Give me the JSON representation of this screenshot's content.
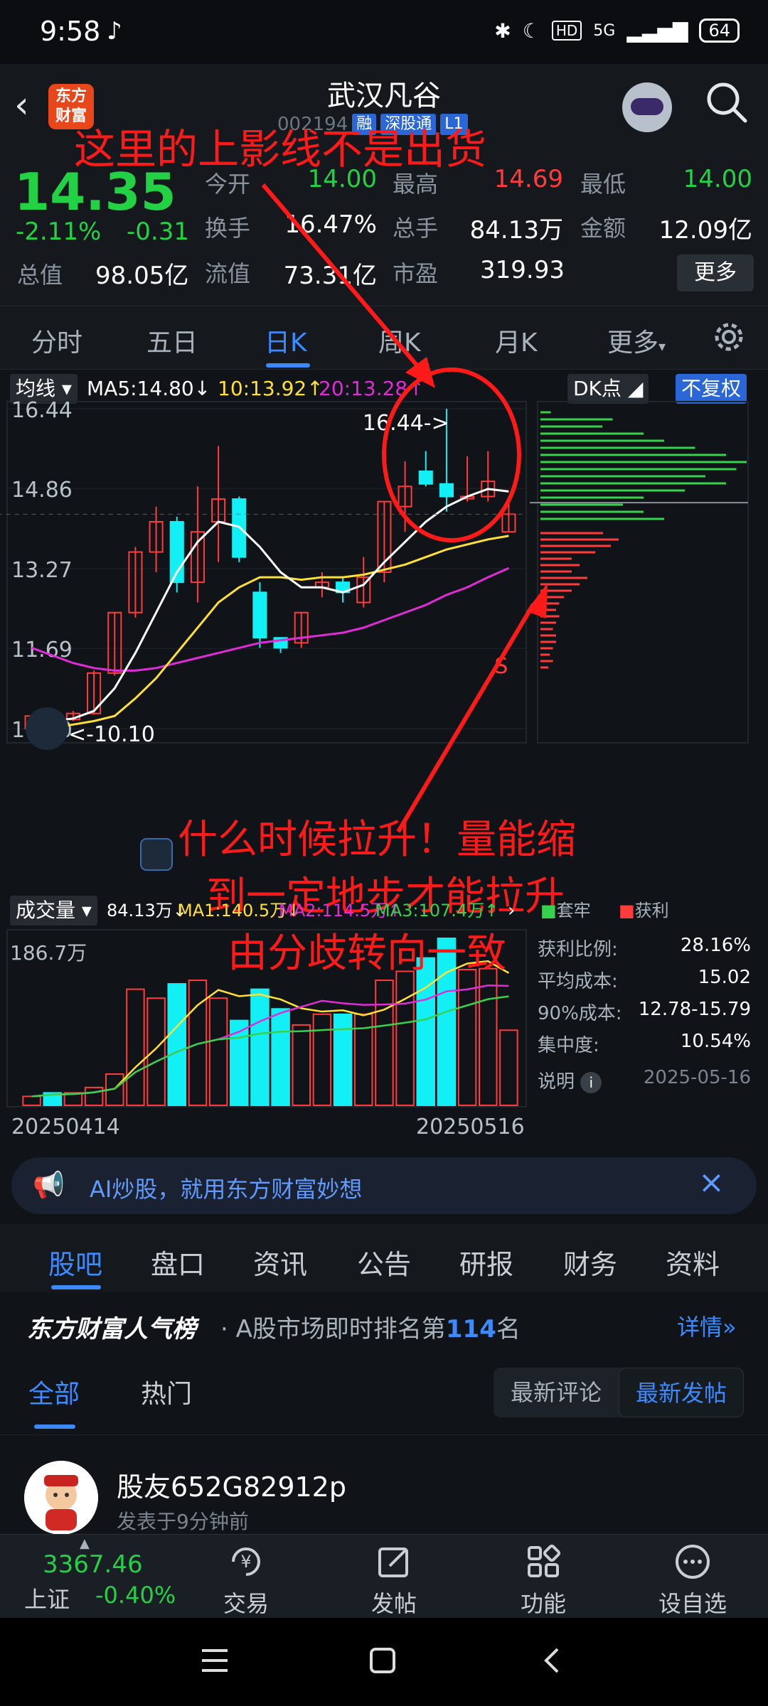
{
  "status_bar": {
    "time": "9:58",
    "network": "5G",
    "hd": "HD",
    "battery": "64"
  },
  "header": {
    "back": "‹",
    "logo_line1": "东方",
    "logo_line2": "财富",
    "stock_name": "武汉凡谷",
    "stock_code": "002194",
    "tags": [
      "融",
      "深股通",
      "L1"
    ]
  },
  "quote": {
    "price": "14.35",
    "change_pct": "-2.11%",
    "change": "-0.31",
    "fields": [
      {
        "label": "今开",
        "value": "14.00",
        "color": "#23d244"
      },
      {
        "label": "最高",
        "value": "14.69",
        "color": "#ff3b3b"
      },
      {
        "label": "最低",
        "value": "14.00",
        "color": "#23d244"
      },
      {
        "label": "换手",
        "value": "16.47%",
        "color": "#ffffff"
      },
      {
        "label": "总手",
        "value": "84.13万",
        "color": "#ffffff"
      },
      {
        "label": "金额",
        "value": "12.09亿",
        "color": "#ffffff"
      },
      {
        "label": "流值",
        "value": "73.31亿",
        "color": "#ffffff"
      },
      {
        "label": "市盈",
        "value": "319.93",
        "color": "#ffffff"
      }
    ],
    "total_value_label": "总值",
    "total_value": "98.05亿",
    "more": "更多"
  },
  "period_tabs": [
    "分时",
    "五日",
    "日K",
    "周K",
    "月K",
    "更多"
  ],
  "chart_controls": {
    "ma_selector": "均线",
    "ma5": "MA5:14.80",
    "ma10": "10:13.92",
    "ma20": "20:13.28",
    "dk": "DK点",
    "adjust": "不复权",
    "vol_selector": "成交量",
    "vol_total": "84.13万",
    "vol_ma1": "MA1:140.5万",
    "vol_ma2": "MA2:114.5万",
    "vol_ma3": "MA3:107.4万",
    "profit_legend": "获利",
    "cost_legend": "套牢"
  },
  "chart_data": {
    "type": "candlestick",
    "y_ticks": [
      "16.44",
      "14.86",
      "13.27",
      "11.69",
      "10.10"
    ],
    "ylim": [
      10.1,
      16.44
    ],
    "vol_max_label": "186.7万",
    "date_start": "20250414",
    "date_end": "20250516",
    "high_marker": "16.44->",
    "low_marker": "<-10.10",
    "sell_marker": "S",
    "candles": [
      [
        10.1,
        10.35,
        10.1,
        10.3
      ],
      [
        10.3,
        10.28,
        10.2,
        10.4
      ],
      [
        10.28,
        10.4,
        10.25,
        10.45
      ],
      [
        10.4,
        11.2,
        10.38,
        11.25
      ],
      [
        11.2,
        12.4,
        11.15,
        12.4
      ],
      [
        12.4,
        13.6,
        12.3,
        13.7
      ],
      [
        13.6,
        14.2,
        13.2,
        14.5
      ],
      [
        14.2,
        13.0,
        12.8,
        14.3
      ],
      [
        13.0,
        14.0,
        12.6,
        14.9
      ],
      [
        14.2,
        14.65,
        13.4,
        15.7
      ],
      [
        14.65,
        13.5,
        13.4,
        14.7
      ],
      [
        12.8,
        11.9,
        11.7,
        13.0
      ],
      [
        11.9,
        11.7,
        11.6,
        11.9
      ],
      [
        11.8,
        12.4,
        11.7,
        12.4
      ],
      [
        12.9,
        13.0,
        12.7,
        13.2
      ],
      [
        13.0,
        12.8,
        12.6,
        13.1
      ],
      [
        12.6,
        13.1,
        12.5,
        13.5
      ],
      [
        13.2,
        14.6,
        13.0,
        14.6
      ],
      [
        14.5,
        14.9,
        14.0,
        15.4
      ],
      [
        15.2,
        14.95,
        14.9,
        15.6
      ],
      [
        14.95,
        14.7,
        14.4,
        16.44
      ],
      [
        14.7,
        14.7,
        14.6,
        15.5
      ],
      [
        14.7,
        15.0,
        14.6,
        15.6
      ],
      [
        14.0,
        14.35,
        14.0,
        14.69
      ]
    ],
    "ma5": [
      10.2,
      10.25,
      10.3,
      10.45,
      10.9,
      11.6,
      12.4,
      13.2,
      13.8,
      14.2,
      14.1,
      13.7,
      13.2,
      12.9,
      12.9,
      12.8,
      12.95,
      13.4,
      13.8,
      14.2,
      14.5,
      14.7,
      14.85,
      14.8
    ],
    "ma10": [
      10.1,
      10.12,
      10.18,
      10.25,
      10.35,
      10.7,
      11.1,
      11.6,
      12.1,
      12.6,
      12.9,
      13.1,
      13.1,
      13.05,
      13.1,
      13.1,
      13.15,
      13.25,
      13.35,
      13.5,
      13.65,
      13.75,
      13.85,
      13.92
    ],
    "ma20": [
      11.7,
      11.55,
      11.4,
      11.3,
      11.25,
      11.25,
      11.3,
      11.4,
      11.5,
      11.6,
      11.7,
      11.8,
      11.85,
      11.9,
      11.95,
      12.0,
      12.1,
      12.25,
      12.4,
      12.55,
      12.75,
      12.9,
      13.1,
      13.28
    ],
    "volume": [
      10,
      14,
      14,
      20,
      35,
      130,
      120,
      136,
      140,
      120,
      95,
      130,
      108,
      90,
      102,
      102,
      102,
      140,
      150,
      165,
      187,
      152,
      153,
      84.13
    ],
    "profit_dist": [
      0.05,
      0.35,
      0.3,
      0.5,
      0.6,
      0.75,
      0.9,
      1.0,
      0.95,
      0.8,
      0.9,
      0.7,
      0.5,
      0.4,
      0.5,
      0.6
    ],
    "trapped_dist": [
      0.4,
      0.5,
      0.45,
      0.35,
      0.2,
      0.25,
      0.2,
      0.3,
      0.25,
      0.2,
      0.15,
      0.12,
      0.1,
      0.12,
      0.1,
      0.08,
      0.1,
      0.1,
      0.08,
      0.06,
      0.08,
      0.05
    ]
  },
  "chip_stats": [
    {
      "label": "获利比例:",
      "value": "28.16%"
    },
    {
      "label": "平均成本:",
      "value": "15.02"
    },
    {
      "label": "90%成本:",
      "value": "12.78-15.79"
    },
    {
      "label": "集中度:",
      "value": "10.54%"
    }
  ],
  "chip_footer": {
    "label": "说明",
    "date": "2025-05-16"
  },
  "annotations": {
    "top": "这里的上影线不是出货",
    "bottom_line1": "什么时候拉升！量能缩",
    "bottom_line2": "到一定地步才能拉升",
    "bottom_line3": "由分歧转向一致"
  },
  "ai_banner": {
    "text": "AI炒股，就用东方财富妙想"
  },
  "info_tabs": [
    "股吧",
    "盘口",
    "资讯",
    "公告",
    "研报",
    "财务",
    "资料"
  ],
  "rank_bar": {
    "brand": "东方财富人气榜",
    "text_pre": "A股市场即时排名第",
    "rank": "114",
    "text_post": "名",
    "detail": "详情"
  },
  "feed_tabs": [
    "全部",
    "热门"
  ],
  "sort_options": [
    "最新评论",
    "最新发帖"
  ],
  "post": {
    "user": "股友652G82912p",
    "time": "发表于9分钟前"
  },
  "bottom_nav": {
    "index_value": "3367.46",
    "index_name": "上证",
    "index_pct": "-0.40%",
    "items": [
      "交易",
      "发帖",
      "功能",
      "设自选"
    ]
  }
}
